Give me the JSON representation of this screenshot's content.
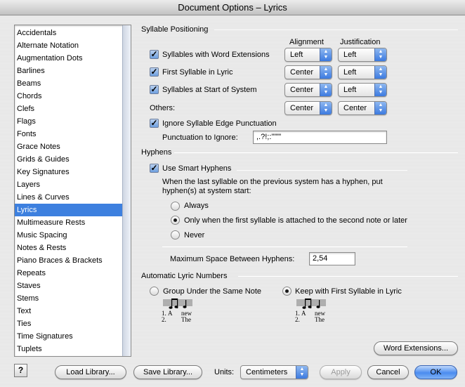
{
  "window": {
    "title": "Document Options – Lyrics"
  },
  "sidebar": {
    "items": [
      {
        "label": "Accidentals"
      },
      {
        "label": "Alternate Notation"
      },
      {
        "label": "Augmentation Dots"
      },
      {
        "label": "Barlines"
      },
      {
        "label": "Beams"
      },
      {
        "label": "Chords"
      },
      {
        "label": "Clefs"
      },
      {
        "label": "Flags"
      },
      {
        "label": "Fonts"
      },
      {
        "label": "Grace Notes"
      },
      {
        "label": "Grids & Guides"
      },
      {
        "label": "Key Signatures"
      },
      {
        "label": "Layers"
      },
      {
        "label": "Lines & Curves"
      },
      {
        "label": "Lyrics",
        "selected": true
      },
      {
        "label": "Multimeasure Rests"
      },
      {
        "label": "Music Spacing"
      },
      {
        "label": "Notes & Rests"
      },
      {
        "label": "Piano Braces & Brackets"
      },
      {
        "label": "Repeats"
      },
      {
        "label": "Staves"
      },
      {
        "label": "Stems"
      },
      {
        "label": "Text"
      },
      {
        "label": "Ties"
      },
      {
        "label": "Time Signatures"
      },
      {
        "label": "Tuplets"
      }
    ]
  },
  "syllable_positioning": {
    "group_label": "Syllable Positioning",
    "col_alignment": "Alignment",
    "col_justification": "Justification",
    "rows": [
      {
        "label": "Syllables with Word Extensions",
        "checked": true,
        "alignment": "Left",
        "justification": "Left"
      },
      {
        "label": "First Syllable in Lyric",
        "checked": true,
        "alignment": "Center",
        "justification": "Left"
      },
      {
        "label": "Syllables at Start of System",
        "checked": true,
        "alignment": "Center",
        "justification": "Left"
      }
    ],
    "others": {
      "label": "Others:",
      "alignment": "Center",
      "justification": "Center"
    },
    "ignore_punct": {
      "label": "Ignore Syllable Edge Punctuation",
      "checked": true
    },
    "punct_to_ignore": {
      "label": "Punctuation to Ignore:",
      "value": ",.?!;:'\"\"\""
    }
  },
  "hyphens": {
    "group_label": "Hyphens",
    "smart": {
      "label": "Use Smart Hyphens",
      "checked": true
    },
    "description": "When the last syllable on the previous system has a hyphen, put hyphen(s) at system start:",
    "options": [
      {
        "label": "Always",
        "selected": false
      },
      {
        "label": "Only when the first syllable is attached to the second note or later",
        "selected": true
      },
      {
        "label": "Never",
        "selected": false
      }
    ],
    "max_space": {
      "label": "Maximum Space Between Hyphens:",
      "value": "2,54"
    }
  },
  "auto_numbers": {
    "group_label": "Automatic Lyric Numbers",
    "group_under": {
      "label": "Group Under the Same Note",
      "selected": false
    },
    "keep_with": {
      "label": "Keep with First Syllable in Lyric",
      "selected": true
    },
    "example": {
      "line1_num": "1.",
      "line1_word1": "A",
      "line1_word2": "new",
      "line2_num": "2.",
      "line2_word": "The"
    }
  },
  "buttons": {
    "word_extensions": "Word Extensions...",
    "help": "?",
    "load_library": "Load Library...",
    "save_library": "Save Library...",
    "units_label": "Units:",
    "units_value": "Centimeters",
    "apply": "Apply",
    "cancel": "Cancel",
    "ok": "OK"
  }
}
